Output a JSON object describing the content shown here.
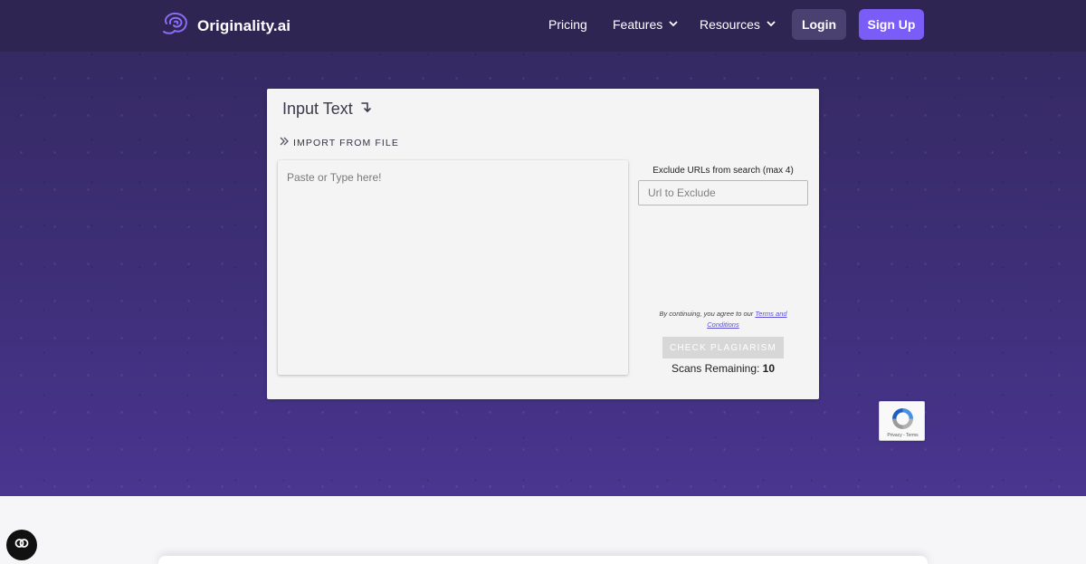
{
  "brand": {
    "name": "Originality.ai",
    "logo_icon": "brain-logo-icon",
    "accent": "#7a5cf6"
  },
  "nav": {
    "pricing": "Pricing",
    "features": "Features",
    "resources": "Resources",
    "login": "Login",
    "signup": "Sign Up"
  },
  "card": {
    "title": "Input Text",
    "import_label": "IMPORT FROM FILE",
    "textarea_placeholder": "Paste or Type here!",
    "exclude_label": "Exclude URLs from search (max 4)",
    "exclude_placeholder": "Url to Exclude",
    "terms_prefix": "By continuing, you agree to our ",
    "terms_link": "Terms and Conditions",
    "check_button": "CHECK PLAGIARISM",
    "scans_label": "Scans Remaining: ",
    "scans_count": "10"
  },
  "recaptcha": {
    "links": "Privacy - Terms"
  },
  "colors": {
    "header_bg": "#2e2552",
    "hero_bg": "#3f2f7a",
    "login_bg": "#4a4170",
    "signup_bg": "#7a5cf6",
    "check_button_bg": "#d7d7d7"
  }
}
